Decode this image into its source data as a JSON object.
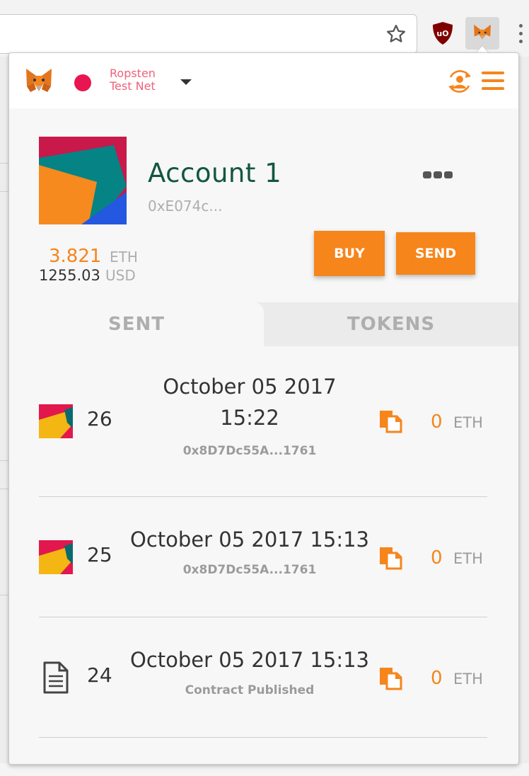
{
  "browser": {
    "extensions": [
      "ublock-origin-icon",
      "metamask-fox-icon"
    ]
  },
  "header": {
    "network_label": "Ropsten Test Net",
    "network_color": "#e91550"
  },
  "account": {
    "name": "Account 1",
    "address": "0xE074c...",
    "balance_eth": "3.821",
    "balance_eth_unit": "ETH",
    "balance_usd": "1255.03",
    "balance_usd_unit": "USD"
  },
  "actions": {
    "buy_label": "BUY",
    "send_label": "SEND"
  },
  "tabs": [
    {
      "label": "SENT",
      "active": true
    },
    {
      "label": "TOKENS",
      "active": false
    }
  ],
  "transactions": [
    {
      "nonce": "26",
      "date": "October 05 2017",
      "time": "15:22",
      "hash": "0x8D7Dc55A...1761",
      "value": "0",
      "unit": "ETH",
      "icon": "identicon"
    },
    {
      "nonce": "25",
      "date": "October 05 2017 15:13",
      "hash": "0x8D7Dc55A...1761",
      "value": "0",
      "unit": "ETH",
      "icon": "identicon"
    },
    {
      "nonce": "24",
      "date": "October 05 2017 15:13",
      "hash": "Contract Published",
      "value": "0",
      "unit": "ETH",
      "icon": "document-icon"
    }
  ],
  "colors": {
    "accent": "#f6851b",
    "account_name": "#135642",
    "network": "#f0627a"
  }
}
